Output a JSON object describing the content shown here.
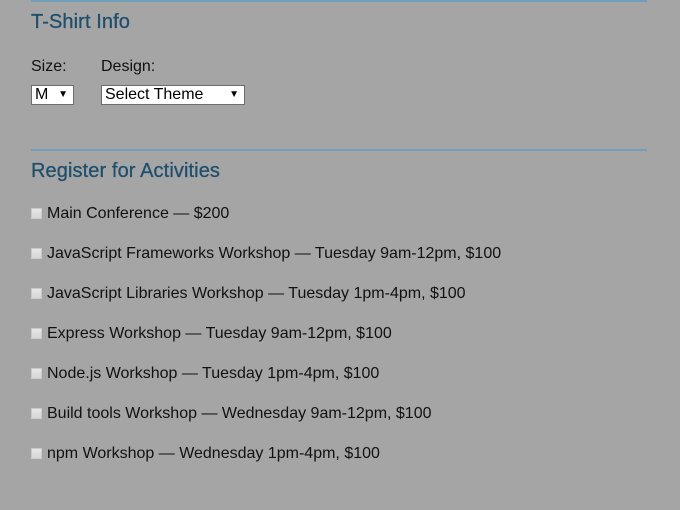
{
  "tshirt": {
    "heading": "T-Shirt Info",
    "size_label": "Size:",
    "size_value": "M",
    "design_label": "Design:",
    "design_value": "Select Theme"
  },
  "activities": {
    "heading": "Register for Activities",
    "items": [
      {
        "label": "Main Conference — $200",
        "checked": false
      },
      {
        "label": "JavaScript Frameworks Workshop — Tuesday 9am-12pm, $100",
        "checked": false
      },
      {
        "label": "JavaScript Libraries Workshop — Tuesday 1pm-4pm, $100",
        "checked": false
      },
      {
        "label": "Express Workshop — Tuesday 9am-12pm, $100",
        "checked": false
      },
      {
        "label": "Node.js Workshop — Tuesday 1pm-4pm, $100",
        "checked": false
      },
      {
        "label": "Build tools Workshop — Wednesday 9am-12pm, $100",
        "checked": false
      },
      {
        "label": "npm Workshop — Wednesday 1pm-4pm, $100",
        "checked": false
      }
    ]
  },
  "icons": {
    "dropdown_arrow": "▼"
  },
  "colors": {
    "page_background": "#a5a5a5",
    "heading": "#1f4f6d",
    "rule": "#6f9fb9"
  }
}
